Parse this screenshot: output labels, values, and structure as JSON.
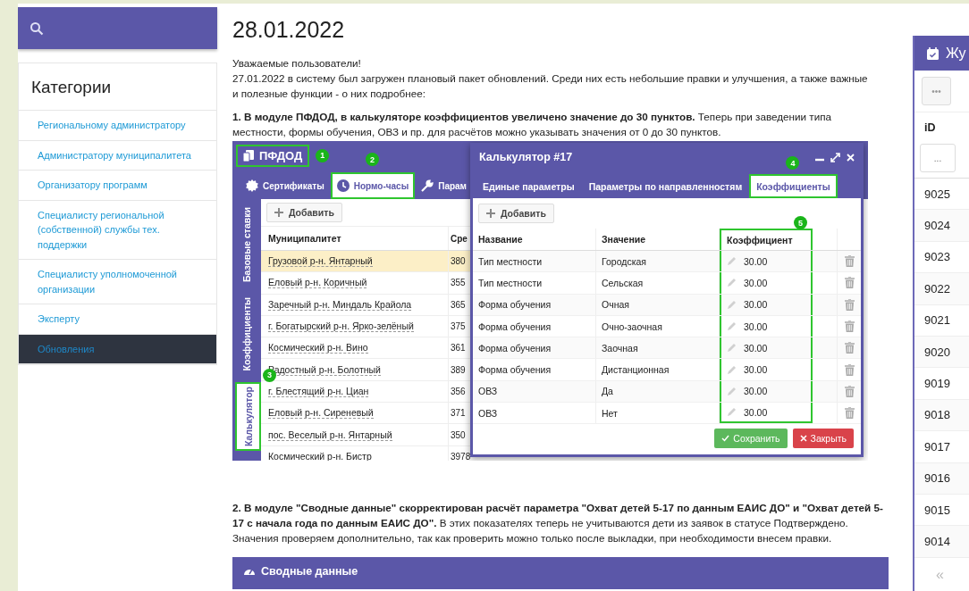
{
  "categories": {
    "title": "Категории",
    "items": [
      {
        "label": "Региональному администратору",
        "selected": false
      },
      {
        "label": "Администратору муниципалитета",
        "selected": false
      },
      {
        "label": "Организатору программ",
        "selected": false
      },
      {
        "label": "Специалисту региональной (собственной) службы тех. поддержки",
        "selected": false
      },
      {
        "label": "Специалисту уполномоченной организации",
        "selected": false
      },
      {
        "label": "Эксперту",
        "selected": false
      },
      {
        "label": "Обновления",
        "selected": true
      }
    ]
  },
  "article": {
    "date": "28.01.2022",
    "greeting": "Уважаемые пользователи!",
    "intro": "27.01.2022 в систему был загружен плановый пакет обновлений. Среди них есть небольшие правки и улучшения, а также важные и полезные функции - о них подробнее:",
    "point_1": "**1. В модуле ПФДОД, в калькуляторе коэффициентов увеличено значение до 30 пунктов.** Теперь при заведении типа местности, формы обучения, ОВЗ и пр. для расчётов можно указывать значения от 0 до 30 пунктов.",
    "point_2": "**2. В модуле \"Сводные данные\" скорректирован расчёт параметра \"Охват детей 5-17 по данным ЕАИС ДО\" и \"Охват детей 5-17 с начала года по данным ЕАИС ДО\".** В этих показателях теперь не учитываются дети из заявок в статусе Подтверждено. Значения проверяем дополнительно, так как проверить можно только после выкладки, при необходимости внесем правки."
  },
  "app": {
    "brand": {
      "label": "ПФДОД",
      "callout": "1"
    },
    "tabs": [
      {
        "label": "Сертификаты",
        "selected": false
      },
      {
        "label": "Нормо-часы",
        "selected": true,
        "callout": "2"
      },
      {
        "label": "Парам",
        "selected": false
      }
    ],
    "side_tabs": [
      {
        "label": "Базовые ставки",
        "selected": false
      },
      {
        "label": "Коэффициенты",
        "selected": false
      },
      {
        "label": "Калькулятор",
        "selected": true,
        "callout": "3"
      }
    ],
    "add_button": "Добавить",
    "columns": [
      "Муниципалитет",
      "Сре"
    ],
    "rows": [
      {
        "cells": [
          "Грузовой р-н. Янтарный",
          "380"
        ],
        "selected": true
      },
      {
        "cells": [
          "Еловый р-н. Коричный",
          "355"
        ],
        "selected": false
      },
      {
        "cells": [
          "Заречный р-н. Миндаль Крайола",
          "365"
        ],
        "selected": false
      },
      {
        "cells": [
          "г. Богатырский р-н. Ярко-зелёный",
          "375"
        ],
        "selected": false
      },
      {
        "cells": [
          "Космический р-н. Вино",
          "361"
        ],
        "selected": false
      },
      {
        "cells": [
          "Радостный р-н. Болотный",
          "389"
        ],
        "selected": false
      },
      {
        "cells": [
          "г. Блестящий р-н. Циан",
          "356"
        ],
        "selected": false
      },
      {
        "cells": [
          "Еловый р-н. Сиреневый",
          "371"
        ],
        "selected": false
      },
      {
        "cells": [
          "пос. Веселый р-н. Янтарный",
          "350"
        ],
        "selected": false
      },
      {
        "cells": [
          "Космический р-н. Бистр",
          "3978"
        ],
        "selected": false
      }
    ]
  },
  "dialog": {
    "title": "Калькулятор #17",
    "tabs": [
      {
        "label": "Единые параметры",
        "selected": false
      },
      {
        "label": "Параметры по направленностям",
        "selected": false
      },
      {
        "label": "Коэффициенты",
        "selected": true,
        "callout": "4"
      }
    ],
    "add_button": "Добавить",
    "columns": [
      {
        "label": "Название",
        "highlighted": false
      },
      {
        "label": "Значение",
        "highlighted": false
      },
      {
        "label": "Коэффициент",
        "highlighted": true,
        "callout": "5"
      }
    ],
    "rows": [
      {
        "name": "Тип местности",
        "value": "Городская",
        "coefficient": "30.00"
      },
      {
        "name": "Тип местности",
        "value": "Сельская",
        "coefficient": "30.00"
      },
      {
        "name": "Форма обучения",
        "value": "Очная",
        "coefficient": "30.00"
      },
      {
        "name": "Форма обучения",
        "value": "Очно-заочная",
        "coefficient": "30.00"
      },
      {
        "name": "Форма обучения",
        "value": "Заочная",
        "coefficient": "30.00"
      },
      {
        "name": "Форма обучения",
        "value": "Дистанционная",
        "coefficient": "30.00"
      },
      {
        "name": "ОВЗ",
        "value": "Да",
        "coefficient": "30.00"
      },
      {
        "name": "ОВЗ",
        "value": "Нет",
        "coefficient": "30.00"
      }
    ],
    "save_button": "Сохранить",
    "close_button": "Закрыть"
  },
  "summary_panel": {
    "title": "Сводные данные"
  },
  "journal": {
    "title": "Жу",
    "menu_button": "•••",
    "column": "iD",
    "filter_placeholder": "...",
    "rows": [
      "9025",
      "9024",
      "9023",
      "9022",
      "9021",
      "9020",
      "9019",
      "9018",
      "9017",
      "9016",
      "9015",
      "9014"
    ],
    "pager": "«"
  }
}
